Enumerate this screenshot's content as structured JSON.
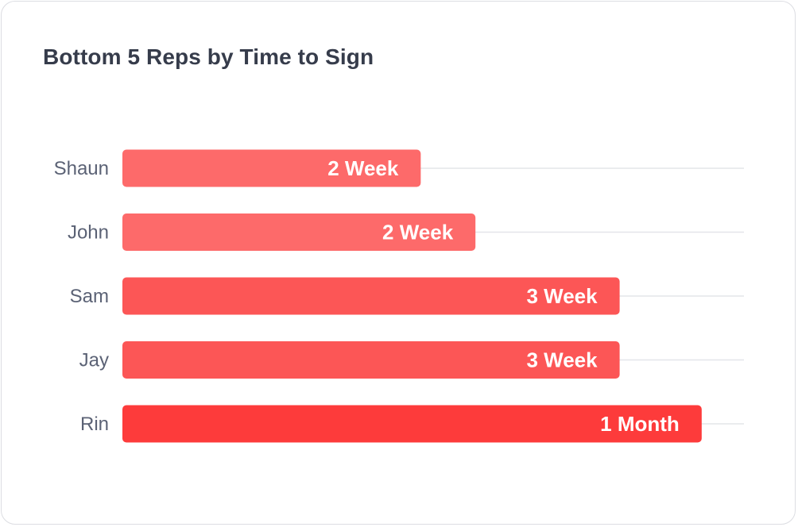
{
  "card": {
    "title": "Bottom 5 Reps by Time to Sign"
  },
  "chart_data": {
    "type": "bar",
    "orientation": "horizontal",
    "title": "Bottom 5 Reps by Time to Sign",
    "categories": [
      "Shaun",
      "John",
      "Sam",
      "Jay",
      "Rin"
    ],
    "values": [
      12,
      14.2,
      20,
      20,
      23.3
    ],
    "value_labels": [
      "2 Week",
      "2 Week",
      "3 Week",
      "3 Week",
      "1 Month"
    ],
    "colors": [
      "#fd6a6a",
      "#fd6a6a",
      "#fc5656",
      "#fc5656",
      "#fd3b3b"
    ],
    "xlabel": "",
    "ylabel": "",
    "xlim": [
      0,
      25
    ],
    "grid": true,
    "legend": "none"
  }
}
